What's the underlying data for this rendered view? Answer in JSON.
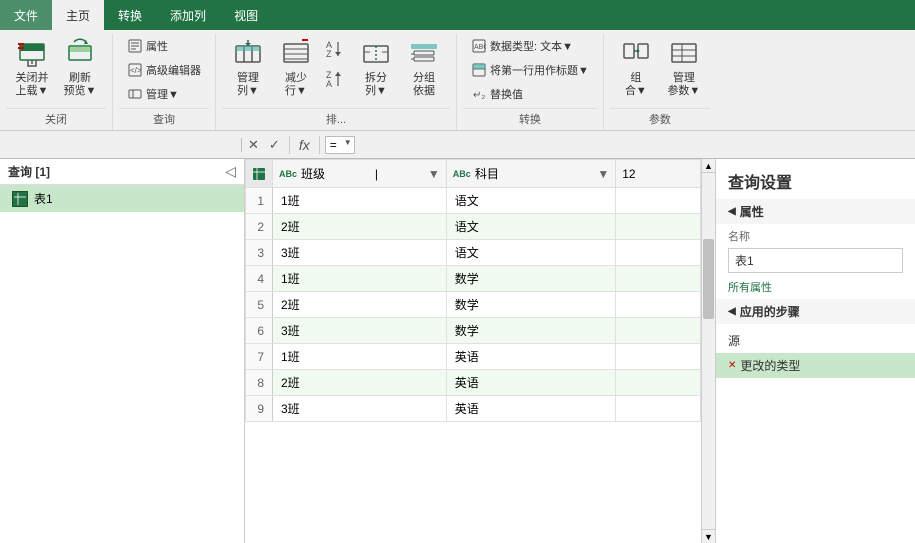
{
  "tabs": [
    {
      "label": "文件",
      "active": false
    },
    {
      "label": "主页",
      "active": true
    },
    {
      "label": "转换",
      "active": false
    },
    {
      "label": "添加列",
      "active": false
    },
    {
      "label": "视图",
      "active": false
    }
  ],
  "ribbon": {
    "groups": [
      {
        "name": "close",
        "label": "关闭",
        "buttons": [
          {
            "id": "close-upload",
            "label": "关闭并\n上载▼",
            "type": "large"
          },
          {
            "id": "refresh",
            "label": "刷新\n预览▼",
            "type": "large"
          }
        ]
      },
      {
        "name": "query",
        "label": "查询",
        "buttons": [
          {
            "id": "properties",
            "label": "属性",
            "type": "small"
          },
          {
            "id": "advanced-editor",
            "label": "高级编辑器",
            "type": "small"
          },
          {
            "id": "manage",
            "label": "管理▼",
            "type": "small"
          }
        ]
      },
      {
        "name": "manage-cols",
        "label": "排...",
        "buttons": [
          {
            "id": "manage-cols",
            "label": "管理\n列▼",
            "type": "large"
          },
          {
            "id": "reduce-rows",
            "label": "减少\n行▼",
            "type": "large"
          },
          {
            "id": "sort",
            "label": "",
            "type": "sort"
          },
          {
            "id": "split-col",
            "label": "拆分\n列▼",
            "type": "large"
          },
          {
            "id": "group-by",
            "label": "分组\n依据",
            "type": "large"
          }
        ]
      },
      {
        "name": "transform",
        "label": "转换",
        "buttons": [
          {
            "id": "data-type",
            "label": "数据类型: 文本▼",
            "type": "top-small"
          },
          {
            "id": "first-row",
            "label": "将第一行用作标题▼",
            "type": "top-small"
          },
          {
            "id": "replace-val",
            "label": "↵₂ 替换值",
            "type": "top-small"
          }
        ]
      },
      {
        "name": "combine",
        "label": "参数",
        "buttons": [
          {
            "id": "combine",
            "label": "组\n合▼",
            "type": "large"
          },
          {
            "id": "manage-params",
            "label": "管理\n参数▼",
            "type": "large"
          }
        ]
      }
    ]
  },
  "formula_bar": {
    "cancel_label": "✕",
    "confirm_label": "✓",
    "fx_label": "fx",
    "formula_value": "=",
    "dropdown_option": "="
  },
  "query_panel": {
    "title": "查询 [1]",
    "items": [
      {
        "label": "表1",
        "type": "table"
      }
    ]
  },
  "table": {
    "columns": [
      {
        "id": "row-num",
        "label": "",
        "type": ""
      },
      {
        "id": "class",
        "label": "班级",
        "type": "ABc"
      },
      {
        "id": "subject",
        "label": "科目",
        "type": "ABc"
      },
      {
        "id": "score",
        "label": "12",
        "type": "12"
      }
    ],
    "rows": [
      {
        "num": "1",
        "class": "1班",
        "subject": "语文"
      },
      {
        "num": "2",
        "class": "2班",
        "subject": "语文"
      },
      {
        "num": "3",
        "class": "3班",
        "subject": "语文"
      },
      {
        "num": "4",
        "class": "1班",
        "subject": "数学"
      },
      {
        "num": "5",
        "class": "2班",
        "subject": "数学"
      },
      {
        "num": "6",
        "class": "3班",
        "subject": "数学"
      },
      {
        "num": "7",
        "class": "1班",
        "subject": "英语"
      },
      {
        "num": "8",
        "class": "2班",
        "subject": "英语"
      },
      {
        "num": "9",
        "class": "3班",
        "subject": "英语"
      }
    ]
  },
  "right_panel": {
    "title": "查询设置",
    "properties_section": "属性",
    "name_label": "名称",
    "name_value": "表1",
    "all_props_label": "所有属性",
    "steps_section": "应用的步骤",
    "steps": [
      {
        "label": "源",
        "has_delete": false,
        "active": false
      },
      {
        "label": "更改的类型",
        "has_delete": true,
        "active": true
      }
    ]
  },
  "colors": {
    "accent_green": "#217346",
    "light_green_bg": "#c8e6c9",
    "ribbon_bg": "#f0f0f0",
    "tab_active_text": "#333",
    "tab_bar_bg": "#217346"
  }
}
